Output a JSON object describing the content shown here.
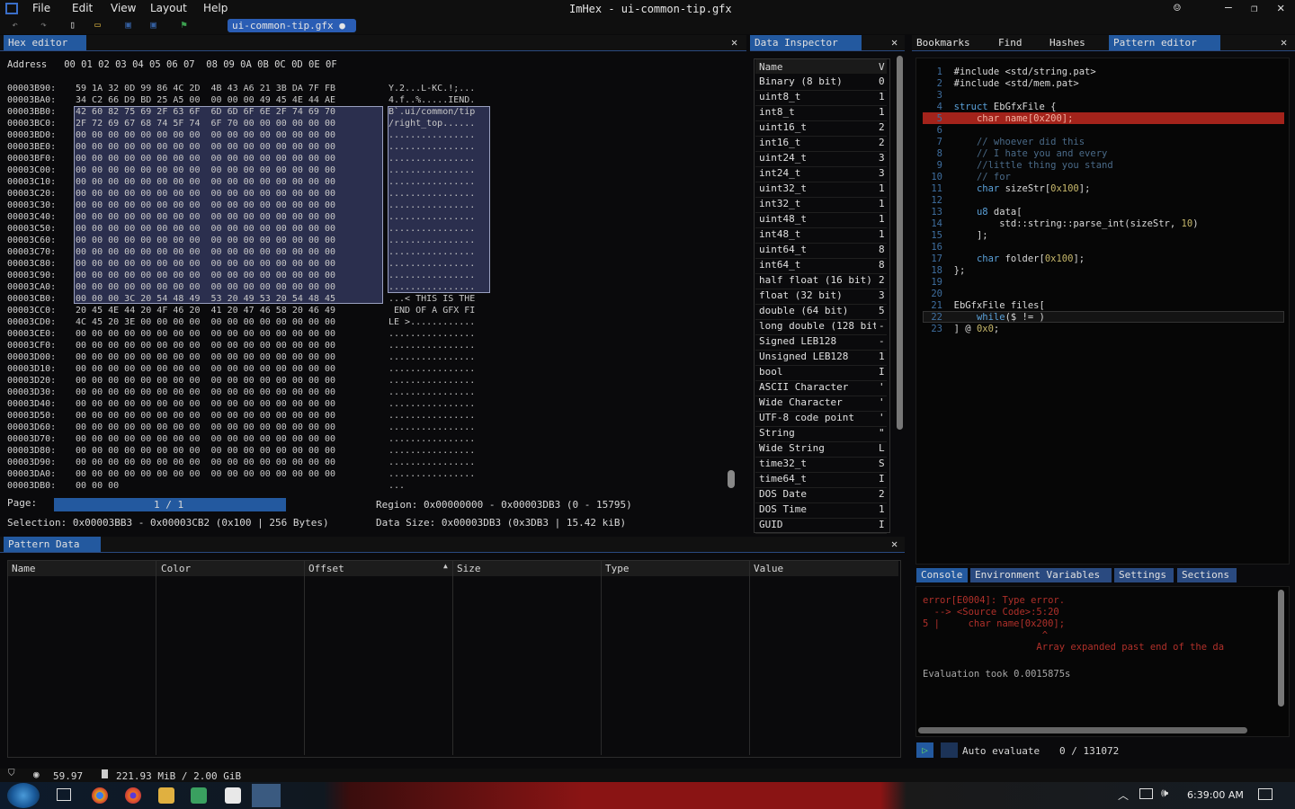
{
  "window": {
    "title": "ImHex - ui-common-tip.gfx"
  },
  "menu": [
    "File",
    "Edit",
    "View",
    "Layout",
    "Help"
  ],
  "file_tab": "ui-common-tip.gfx ●",
  "hex_editor": {
    "tab": "Hex editor",
    "header": "Address   00 01 02 03 04 05 06 07  08 09 0A 0B 0C 0D 0E 0F",
    "rows": [
      [
        "00003B90:",
        "59 1A 32 0D 99 86 4C 2D  4B 43 A6 21 3B DA 7F FB",
        "Y.2...L-KC.!;..."
      ],
      [
        "00003BA0:",
        "34 C2 66 D9 BD 25 A5 00  00 00 00 49 45 4E 44 AE",
        "4.f..%.....IEND."
      ],
      [
        "00003BB0:",
        "42 60 82 75 69 2F 63 6F  6D 6D 6F 6E 2F 74 69 70",
        "B`.ui/common/tip"
      ],
      [
        "00003BC0:",
        "2F 72 69 67 68 74 5F 74  6F 70 00 00 00 00 00 00",
        "/right_top......"
      ],
      [
        "00003BD0:",
        "00 00 00 00 00 00 00 00  00 00 00 00 00 00 00 00",
        "................"
      ],
      [
        "00003BE0:",
        "00 00 00 00 00 00 00 00  00 00 00 00 00 00 00 00",
        "................"
      ],
      [
        "00003BF0:",
        "00 00 00 00 00 00 00 00  00 00 00 00 00 00 00 00",
        "................"
      ],
      [
        "00003C00:",
        "00 00 00 00 00 00 00 00  00 00 00 00 00 00 00 00",
        "................"
      ],
      [
        "00003C10:",
        "00 00 00 00 00 00 00 00  00 00 00 00 00 00 00 00",
        "................"
      ],
      [
        "00003C20:",
        "00 00 00 00 00 00 00 00  00 00 00 00 00 00 00 00",
        "................"
      ],
      [
        "00003C30:",
        "00 00 00 00 00 00 00 00  00 00 00 00 00 00 00 00",
        "................"
      ],
      [
        "00003C40:",
        "00 00 00 00 00 00 00 00  00 00 00 00 00 00 00 00",
        "................"
      ],
      [
        "00003C50:",
        "00 00 00 00 00 00 00 00  00 00 00 00 00 00 00 00",
        "................"
      ],
      [
        "00003C60:",
        "00 00 00 00 00 00 00 00  00 00 00 00 00 00 00 00",
        "................"
      ],
      [
        "00003C70:",
        "00 00 00 00 00 00 00 00  00 00 00 00 00 00 00 00",
        "................"
      ],
      [
        "00003C80:",
        "00 00 00 00 00 00 00 00  00 00 00 00 00 00 00 00",
        "................"
      ],
      [
        "00003C90:",
        "00 00 00 00 00 00 00 00  00 00 00 00 00 00 00 00",
        "................"
      ],
      [
        "00003CA0:",
        "00 00 00 00 00 00 00 00  00 00 00 00 00 00 00 00",
        "................"
      ],
      [
        "00003CB0:",
        "00 00 00 3C 20 54 48 49  53 20 49 53 20 54 48 45",
        "...< THIS IS THE"
      ],
      [
        "00003CC0:",
        "20 45 4E 44 20 4F 46 20  41 20 47 46 58 20 46 49",
        " END OF A GFX FI"
      ],
      [
        "00003CD0:",
        "4C 45 20 3E 00 00 00 00  00 00 00 00 00 00 00 00",
        "LE >............"
      ],
      [
        "00003CE0:",
        "00 00 00 00 00 00 00 00  00 00 00 00 00 00 00 00",
        "................"
      ],
      [
        "00003CF0:",
        "00 00 00 00 00 00 00 00  00 00 00 00 00 00 00 00",
        "................"
      ],
      [
        "00003D00:",
        "00 00 00 00 00 00 00 00  00 00 00 00 00 00 00 00",
        "................"
      ],
      [
        "00003D10:",
        "00 00 00 00 00 00 00 00  00 00 00 00 00 00 00 00",
        "................"
      ],
      [
        "00003D20:",
        "00 00 00 00 00 00 00 00  00 00 00 00 00 00 00 00",
        "................"
      ],
      [
        "00003D30:",
        "00 00 00 00 00 00 00 00  00 00 00 00 00 00 00 00",
        "................"
      ],
      [
        "00003D40:",
        "00 00 00 00 00 00 00 00  00 00 00 00 00 00 00 00",
        "................"
      ],
      [
        "00003D50:",
        "00 00 00 00 00 00 00 00  00 00 00 00 00 00 00 00",
        "................"
      ],
      [
        "00003D60:",
        "00 00 00 00 00 00 00 00  00 00 00 00 00 00 00 00",
        "................"
      ],
      [
        "00003D70:",
        "00 00 00 00 00 00 00 00  00 00 00 00 00 00 00 00",
        "................"
      ],
      [
        "00003D80:",
        "00 00 00 00 00 00 00 00  00 00 00 00 00 00 00 00",
        "................"
      ],
      [
        "00003D90:",
        "00 00 00 00 00 00 00 00  00 00 00 00 00 00 00 00",
        "................"
      ],
      [
        "00003DA0:",
        "00 00 00 00 00 00 00 00  00 00 00 00 00 00 00 00",
        "................"
      ],
      [
        "00003DB0:",
        "00 00 00",
        "..."
      ]
    ],
    "page_label": "Page:",
    "page_value": "1 / 1",
    "region": "Region: 0x00000000 - 0x00003DB3 (0 - 15795)",
    "selection": "Selection: 0x00003BB3 - 0x00003CB2 (0x100 | 256 Bytes)",
    "data_size": "Data Size: 0x00003DB3 (0x3DB3 | 15.42 kiB)"
  },
  "data_inspector": {
    "tab": "Data Inspector",
    "col_name": "Name",
    "col_value": "V",
    "rows": [
      [
        "Binary (8 bit)",
        "0"
      ],
      [
        "uint8_t",
        "1"
      ],
      [
        "int8_t",
        "1"
      ],
      [
        "uint16_t",
        "2"
      ],
      [
        "int16_t",
        "2"
      ],
      [
        "uint24_t",
        "3"
      ],
      [
        "int24_t",
        "3"
      ],
      [
        "uint32_t",
        "1"
      ],
      [
        "int32_t",
        "1"
      ],
      [
        "uint48_t",
        "1"
      ],
      [
        "int48_t",
        "1"
      ],
      [
        "uint64_t",
        "8"
      ],
      [
        "int64_t",
        "8"
      ],
      [
        "half float (16 bit)",
        "2"
      ],
      [
        "float (32 bit)",
        "3"
      ],
      [
        "double (64 bit)",
        "5"
      ],
      [
        "long double (128 bit)",
        "-"
      ],
      [
        "Signed LEB128",
        "-"
      ],
      [
        "Unsigned LEB128",
        "1"
      ],
      [
        "bool",
        "I"
      ],
      [
        "ASCII Character",
        "'"
      ],
      [
        "Wide Character",
        "'"
      ],
      [
        "UTF-8 code point",
        "'"
      ],
      [
        "String",
        "\""
      ],
      [
        "Wide String",
        "L"
      ],
      [
        "time32_t",
        "S"
      ],
      [
        "time64_t",
        "I"
      ],
      [
        "DOS Date",
        "2"
      ],
      [
        "DOS Time",
        "1"
      ],
      [
        "GUID",
        "I"
      ]
    ]
  },
  "right_tabs": [
    "Bookmarks",
    "Find",
    "Hashes",
    "Pattern editor"
  ],
  "pattern_editor": {
    "lines": [
      [
        {
          "t": "#include <std/string.pat>",
          "c": "plain"
        }
      ],
      [
        {
          "t": "#include <std/mem.pat>",
          "c": "plain"
        }
      ],
      [],
      [
        {
          "t": "struct ",
          "c": "kw"
        },
        {
          "t": "EbGfxFile {",
          "c": "plain"
        }
      ],
      [
        {
          "t": "    char ",
          "c": "kw"
        },
        {
          "t": "name[",
          "c": "plain"
        },
        {
          "t": "0x200",
          "c": "num"
        },
        {
          "t": "];",
          "c": "plain"
        }
      ],
      [],
      [
        {
          "t": "    // whoever did this",
          "c": "cmt"
        }
      ],
      [
        {
          "t": "    // I hate you and every",
          "c": "cmt"
        }
      ],
      [
        {
          "t": "    //little thing you stand",
          "c": "cmt"
        }
      ],
      [
        {
          "t": "    // for",
          "c": "cmt"
        }
      ],
      [
        {
          "t": "    char ",
          "c": "kw"
        },
        {
          "t": "sizeStr[",
          "c": "plain"
        },
        {
          "t": "0x100",
          "c": "num"
        },
        {
          "t": "];",
          "c": "plain"
        }
      ],
      [],
      [
        {
          "t": "    u8 ",
          "c": "kw"
        },
        {
          "t": "data[",
          "c": "plain"
        }
      ],
      [
        {
          "t": "        std::string::parse_int(sizeStr, ",
          "c": "plain"
        },
        {
          "t": "10",
          "c": "num"
        },
        {
          "t": ")",
          "c": "plain"
        }
      ],
      [
        {
          "t": "    ];",
          "c": "plain"
        }
      ],
      [],
      [
        {
          "t": "    char ",
          "c": "kw"
        },
        {
          "t": "folder[",
          "c": "plain"
        },
        {
          "t": "0x100",
          "c": "num"
        },
        {
          "t": "];",
          "c": "plain"
        }
      ],
      [
        {
          "t": "};",
          "c": "plain"
        }
      ],
      [],
      [],
      [
        {
          "t": "EbGfxFile files[",
          "c": "plain"
        }
      ],
      [
        {
          "t": "    while",
          "c": "kw"
        },
        {
          "t": "($ != )",
          "c": "plain"
        }
      ],
      [
        {
          "t": "] @ ",
          "c": "plain"
        },
        {
          "t": "0x0",
          "c": "num"
        },
        {
          "t": ";",
          "c": "plain"
        }
      ]
    ]
  },
  "console_tabs": [
    "Console",
    "Environment Variables",
    "Settings",
    "Sections"
  ],
  "console": {
    "error_lines": [
      "error[E0004]: Type error.",
      "  --> <Source Code>:5:20",
      "5 |     char name[0x200];",
      "                     ^",
      "                    Array expanded past end of the da"
    ],
    "eval_time": "Evaluation took 0.0015875s",
    "auto_evaluate": "Auto evaluate",
    "counter": "0 / 131072"
  },
  "pattern_data": {
    "tab": "Pattern Data",
    "columns": [
      "Name",
      "Color",
      "Offset",
      "Size",
      "Type",
      "Value"
    ]
  },
  "statusbar": {
    "fps": "59.97",
    "memory": "221.93 MiB / 2.00 GiB"
  },
  "taskbar": {
    "clock": "6:39:00 AM"
  }
}
